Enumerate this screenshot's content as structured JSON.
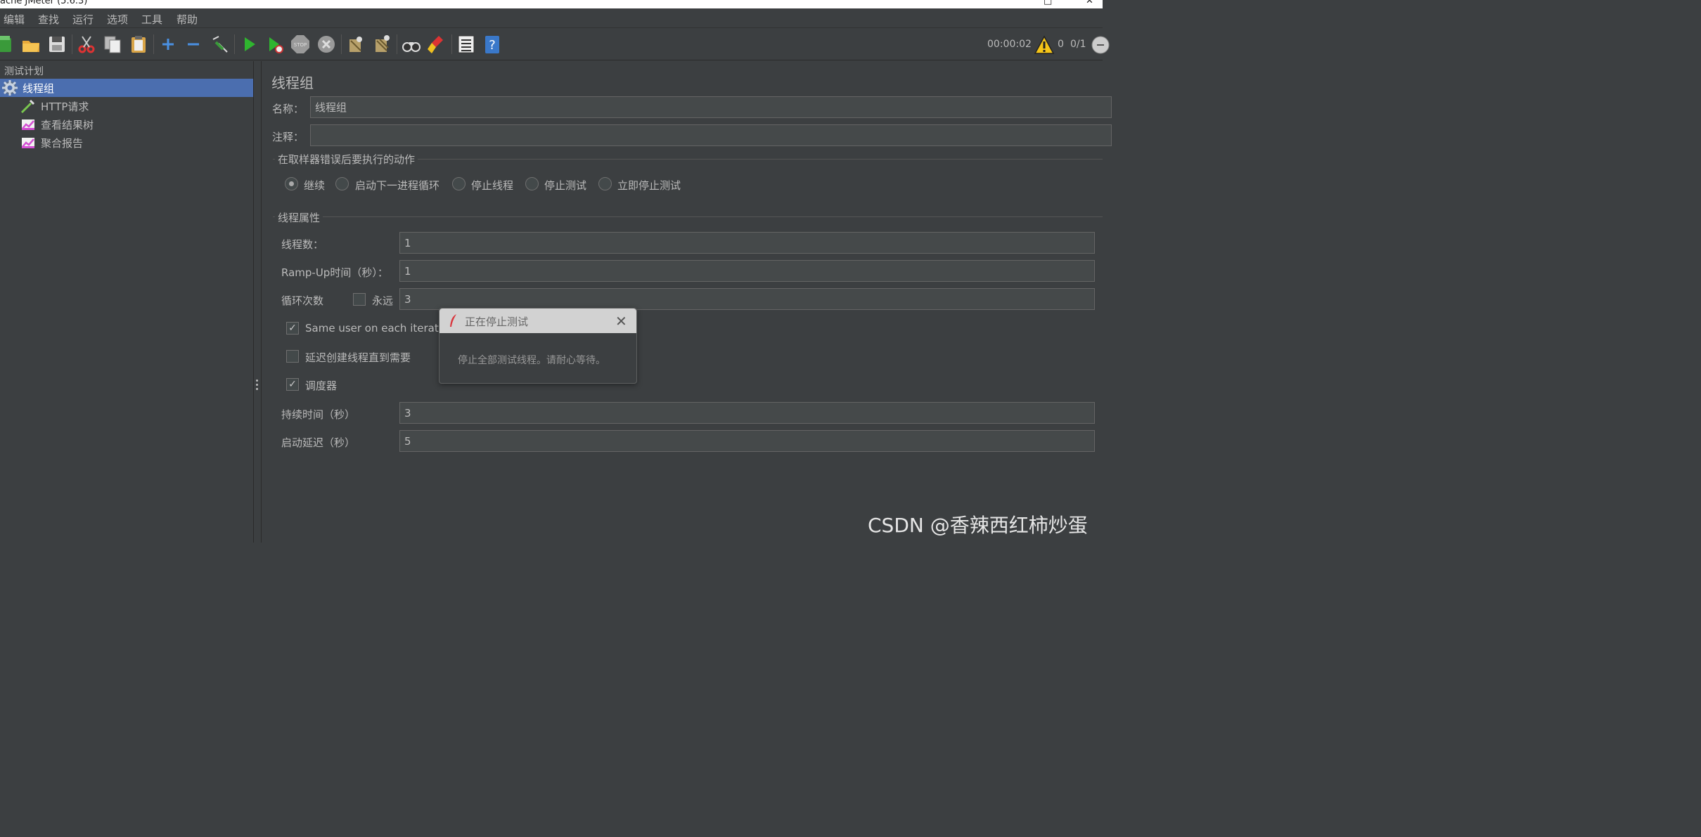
{
  "window": {
    "title": "ache JMeter (5.6.3)"
  },
  "menu": [
    "编辑",
    "查找",
    "运行",
    "选项",
    "工具",
    "帮助"
  ],
  "toolbar": {
    "timer": "00:00:02",
    "warnings": "0",
    "threads": "0/1",
    "icons": [
      "templates-icon",
      "open-icon",
      "save-icon",
      "cut-icon",
      "copy-icon",
      "paste-icon",
      "expand-icon",
      "collapse-icon",
      "toggle-icon",
      "start-icon",
      "start-no-pause-icon",
      "stop-icon",
      "shutdown-icon",
      "clear-icon",
      "clear-all-icon",
      "search-icon",
      "reset-search-icon",
      "function-helper-icon",
      "help-icon"
    ]
  },
  "tree": {
    "root": "测试计划",
    "items": [
      {
        "label": "线程组",
        "icon": "gear-icon",
        "selected": true
      },
      {
        "label": "HTTP请求",
        "icon": "pipette-icon",
        "selected": false
      },
      {
        "label": "查看结果树",
        "icon": "listener-chart-icon",
        "selected": false
      },
      {
        "label": "聚合报告",
        "icon": "listener-chart-icon",
        "selected": false
      }
    ]
  },
  "panel": {
    "title": "线程组",
    "name_label": "名称：",
    "name_value": "线程组",
    "comment_label": "注释：",
    "comment_value": "",
    "on_error": {
      "section_label": "在取样器错误后要执行的动作",
      "options": [
        "继续",
        "启动下一进程循环",
        "停止线程",
        "停止测试",
        "立即停止测试"
      ],
      "selected": "继续"
    },
    "thread_props": {
      "section_label": "线程属性",
      "threads_label": "线程数：",
      "threads_value": "1",
      "rampup_label": "Ramp-Up时间（秒）：",
      "rampup_value": "1",
      "loop_label": "循环次数",
      "forever_label": "永远",
      "forever_checked": false,
      "loop_value": "3",
      "same_user_label": "Same user on each iteration",
      "same_user_checked": true,
      "delay_create_label": "延迟创建线程直到需要",
      "delay_create_checked": false,
      "scheduler_label": "调度器",
      "scheduler_checked": true,
      "duration_label": "持续时间（秒）",
      "duration_value": "3",
      "startup_delay_label": "启动延迟（秒）",
      "startup_delay_value": "5"
    }
  },
  "dialog": {
    "title": "正在停止测试",
    "message": "停止全部测试线程。请耐心等待。"
  },
  "watermark": "CSDN @香辣西红柿炒蛋"
}
